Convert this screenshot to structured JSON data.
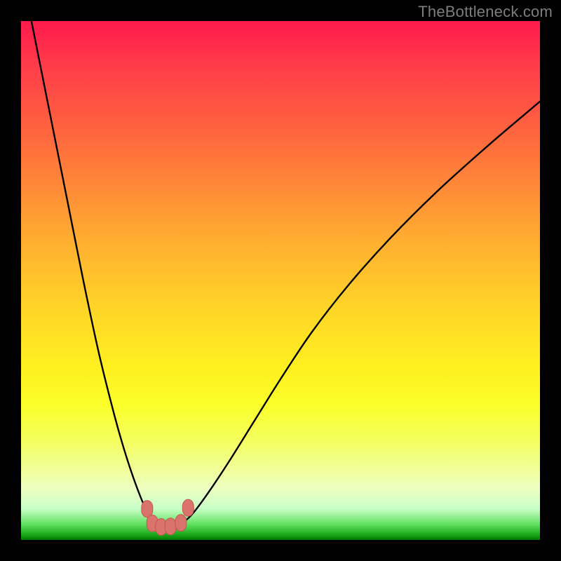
{
  "watermark": "TheBottleneck.com",
  "colors": {
    "frame": "#000000",
    "curve": "#000000",
    "marker_fill": "#d9736b",
    "marker_stroke": "#c05850"
  },
  "chart_data": {
    "type": "line",
    "title": "",
    "xlabel": "",
    "ylabel": "",
    "xlim": [
      0,
      100
    ],
    "ylim": [
      0,
      100
    ],
    "grid": false,
    "series": [
      {
        "name": "bottleneck-curve",
        "x": [
          0,
          3,
          6,
          9,
          12,
          15,
          18,
          20,
          22,
          24,
          25.5,
          26.5,
          27.5,
          29,
          31,
          33,
          36,
          40,
          45,
          50,
          56,
          63,
          71,
          80,
          90,
          100
        ],
        "y": [
          110,
          95,
          80,
          65,
          50,
          36,
          24,
          17,
          11,
          6,
          3.2,
          2.6,
          2.5,
          2.6,
          3.3,
          5,
          9,
          15,
          23,
          31,
          40,
          49,
          58,
          67,
          76,
          84.5
        ]
      }
    ],
    "markers": [
      {
        "x": 24.3,
        "y": 6.0
      },
      {
        "x": 25.3,
        "y": 3.2
      },
      {
        "x": 27.0,
        "y": 2.5
      },
      {
        "x": 28.8,
        "y": 2.6
      },
      {
        "x": 30.8,
        "y": 3.3
      },
      {
        "x": 32.2,
        "y": 6.2
      }
    ],
    "notes": "y expressed as percent of plot height from bottom; x as percent of plot width from left; values estimated from pixels (no axes/labels in source image)."
  }
}
